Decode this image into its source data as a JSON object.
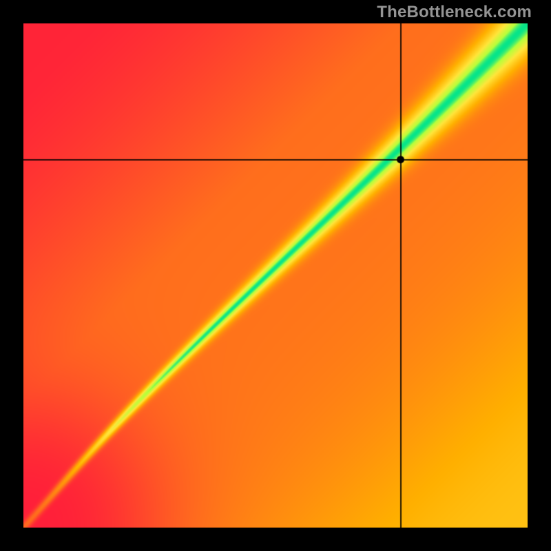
{
  "watermark": {
    "text": "TheBottleneck.com"
  },
  "chart_data": {
    "type": "heatmap",
    "title": "",
    "xlabel": "",
    "ylabel": "",
    "xlim": [
      0,
      100
    ],
    "ylim": [
      0,
      100
    ],
    "crosshair": {
      "x": 74.8,
      "y": 73.0
    },
    "marker": {
      "x": 74.8,
      "y": 73.0,
      "radius_percent": 0.75
    },
    "optimal_curve_description": "Green optimal band follows a superlinear curve from lower-left to upper-right; band is very thin near the origin and widens toward the top-right. Distance from the curve maps to a red→orange→yellow→green gradient.",
    "curve_params": {
      "bend_exp": 1.5,
      "mix_k": 3.5,
      "band_k": 26,
      "origin_sigma": 0.12,
      "side_bias_strength": 0.55,
      "side_bias_sigma": 0.35
    },
    "color_stops": [
      {
        "t": 0.0,
        "hex": "#ff1f3a"
      },
      {
        "t": 0.25,
        "hex": "#ff6a1f"
      },
      {
        "t": 0.5,
        "hex": "#ffb000"
      },
      {
        "t": 0.75,
        "hex": "#ffe63b"
      },
      {
        "t": 0.92,
        "hex": "#b8ff3b"
      },
      {
        "t": 1.0,
        "hex": "#06e58b"
      }
    ]
  }
}
